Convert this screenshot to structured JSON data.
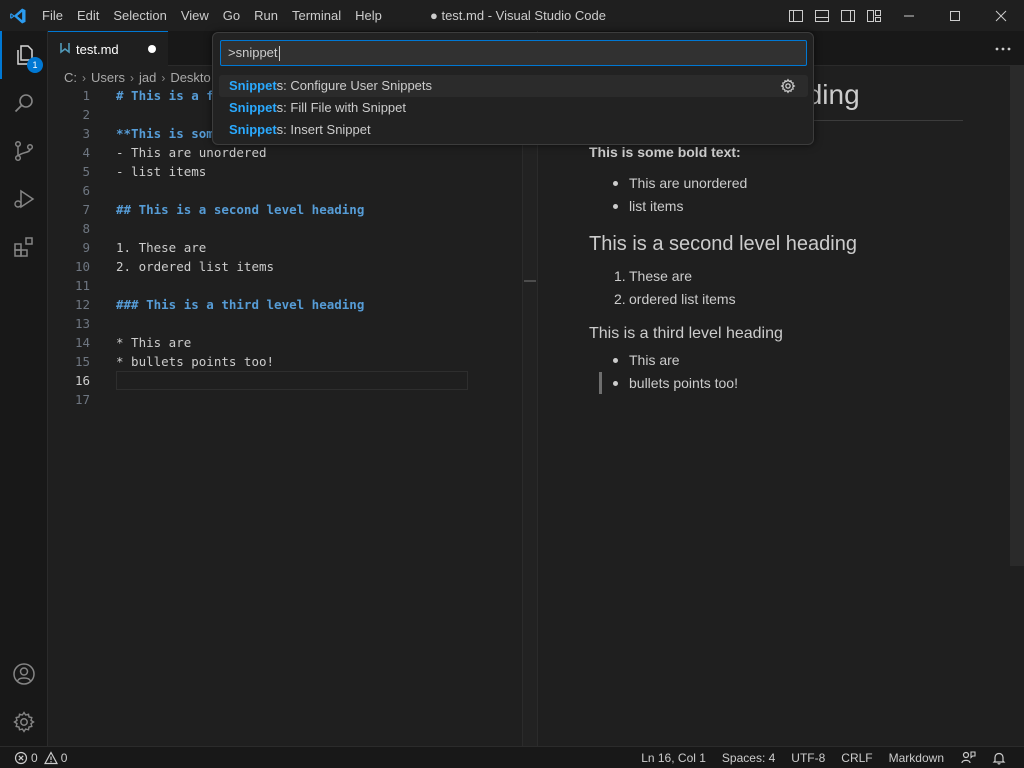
{
  "titlebar": {
    "menu": [
      "File",
      "Edit",
      "Selection",
      "View",
      "Go",
      "Run",
      "Terminal",
      "Help"
    ],
    "title": "● test.md - Visual Studio Code"
  },
  "activitybar": {
    "explorer_badge": "1"
  },
  "tab": {
    "label": "test.md"
  },
  "breadcrumb": [
    "C:",
    "Users",
    "jad",
    "Deskto"
  ],
  "editor": {
    "lines": [
      {
        "n": "1",
        "text": "# This is a f"
      },
      {
        "n": "2",
        "text": ""
      },
      {
        "n": "3",
        "text": "**This is som"
      },
      {
        "n": "4",
        "text": "- This are unordered"
      },
      {
        "n": "5",
        "text": "- list items"
      },
      {
        "n": "6",
        "text": ""
      },
      {
        "n": "7",
        "text": "## This is a second level heading"
      },
      {
        "n": "8",
        "text": ""
      },
      {
        "n": "9",
        "text": "1. These are"
      },
      {
        "n": "10",
        "text": "2. ordered list items"
      },
      {
        "n": "11",
        "text": ""
      },
      {
        "n": "12",
        "text": "### This is a third level heading"
      },
      {
        "n": "13",
        "text": ""
      },
      {
        "n": "14",
        "text": "* This are"
      },
      {
        "n": "15",
        "text": "* bullets points too!"
      },
      {
        "n": "16",
        "text": ""
      },
      {
        "n": "17",
        "text": ""
      }
    ]
  },
  "preview": {
    "h1_fragment": "heading",
    "bold_text": "This is some bold text:",
    "ul1": [
      "This are unordered",
      "list items"
    ],
    "h2": "This is a second level heading",
    "ol": [
      "These are",
      "ordered list items"
    ],
    "ol_markers": [
      "1.",
      "2."
    ],
    "h3": "This is a third level heading",
    "ul2": [
      "This are",
      "bullets points too!"
    ]
  },
  "palette": {
    "query": ">snippet",
    "items": [
      {
        "match": "Snippet",
        "rest": "s: Configure User Snippets"
      },
      {
        "match": "Snippet",
        "rest": "s: Fill File with Snippet"
      },
      {
        "match": "Snippet",
        "rest": "s: Insert Snippet"
      }
    ]
  },
  "statusbar": {
    "errors": "0",
    "warnings": "0",
    "position": "Ln 16, Col 1",
    "spaces": "Spaces: 4",
    "encoding": "UTF-8",
    "eol": "CRLF",
    "language": "Markdown"
  },
  "colors": {
    "accent": "#0078d4",
    "highlight": "#2aaaff",
    "markdown_heading": "#569cd6"
  }
}
